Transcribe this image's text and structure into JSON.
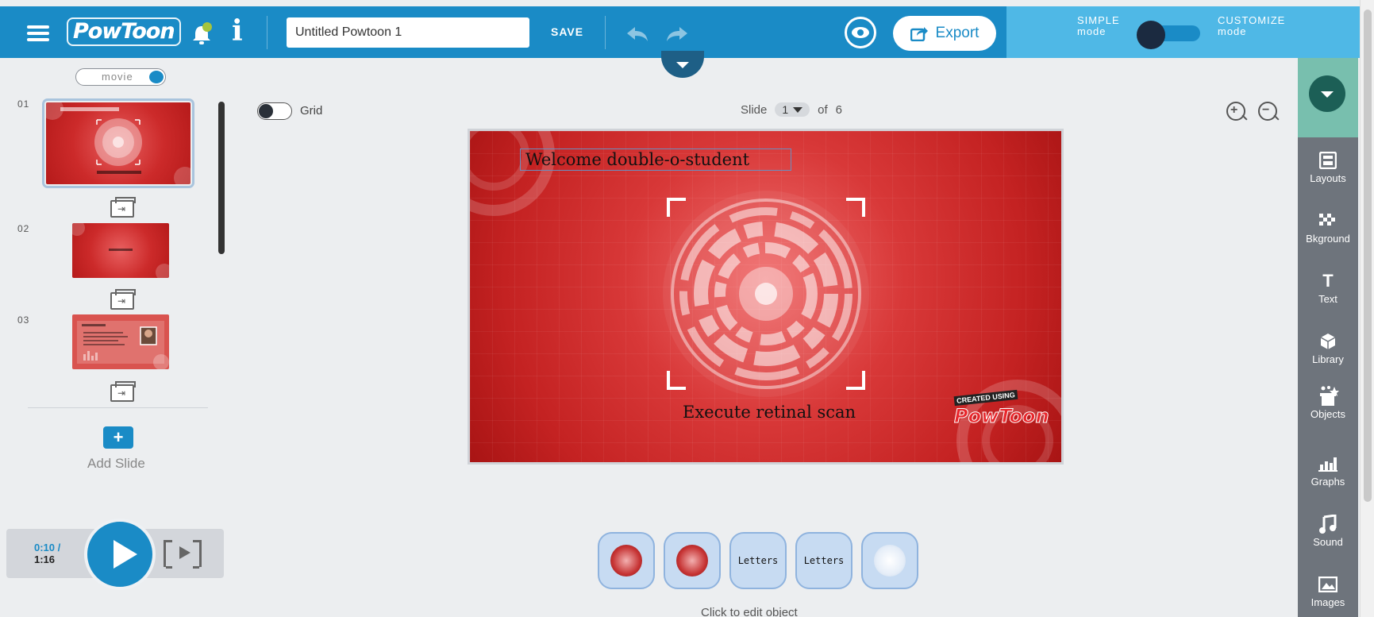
{
  "header": {
    "logo_text": "PowToon",
    "title_value": "Untitled Powtoon 1",
    "save_label": "SAVE",
    "export_label": "Export",
    "mode_simple": [
      "SIMPLE",
      "mode"
    ],
    "mode_customize": [
      "CUSTOMIZE",
      "mode"
    ]
  },
  "left_panel": {
    "movie_toggle_label": "movie",
    "slides": [
      {
        "number": "01",
        "caption": "Welcome double-o-student"
      },
      {
        "number": "02"
      },
      {
        "number": "03"
      }
    ],
    "add_slide_label": "Add Slide"
  },
  "player": {
    "current_time": "0:10 /",
    "total_time": "1:16"
  },
  "editor": {
    "grid_label": "Grid",
    "slide_label": "Slide",
    "current_slide": "1",
    "of_label": "of",
    "total_slides": "6"
  },
  "canvas": {
    "title_text": "Welcome double-o-student",
    "subtitle_text": "Execute retinal scan",
    "badge_top": "CREATED USING",
    "badge_bottom": "PowToon"
  },
  "object_bar": {
    "items": [
      {
        "type": "image",
        "name": "scanner-red"
      },
      {
        "type": "image",
        "name": "scanner-red"
      },
      {
        "type": "text",
        "label": "Letters"
      },
      {
        "type": "text",
        "label": "Letters"
      },
      {
        "type": "image",
        "name": "scanner-light"
      }
    ],
    "hint": "Click to edit object"
  },
  "right_sidebar": {
    "items": [
      {
        "label": "Layouts",
        "icon": "layouts-icon"
      },
      {
        "label": "Bkground",
        "icon": "background-icon"
      },
      {
        "label": "Text",
        "icon": "text-icon"
      },
      {
        "label": "Library",
        "icon": "library-icon"
      },
      {
        "label": "Objects",
        "icon": "objects-icon"
      },
      {
        "label": "Graphs",
        "icon": "graphs-icon"
      },
      {
        "label": "Sound",
        "icon": "sound-icon"
      },
      {
        "label": "Images",
        "icon": "images-icon"
      }
    ]
  },
  "colors": {
    "primary": "#1a8bc6",
    "mode_bar": "#4fb8e6",
    "sidebar": "#6e747c",
    "sidebar_top": "#78bfae",
    "slide_red": "#c42222"
  }
}
